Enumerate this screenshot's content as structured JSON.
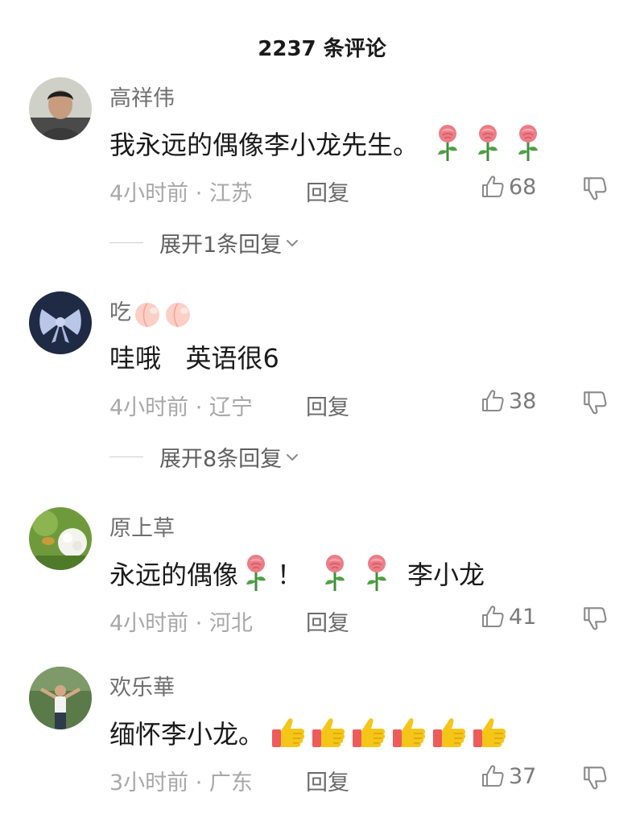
{
  "header": {
    "title": "2237 条评论"
  },
  "comments": [
    {
      "username": "高祥伟",
      "content": "我永远的偶像李小龙先生。",
      "content_emojis": [
        "rose",
        "rose",
        "rose"
      ],
      "time_location": "4小时前 · 江苏",
      "reply_label": "回复",
      "likes": "68",
      "expand_label": "展开1条回复"
    },
    {
      "username": "吃",
      "username_emojis": [
        "peach",
        "peach"
      ],
      "content": "哇哦   英语很6",
      "time_location": "4小时前 · 辽宁",
      "reply_label": "回复",
      "likes": "38",
      "expand_label": "展开8条回复"
    },
    {
      "username": "原上草",
      "content_a": "永远的偶像",
      "content_b": "！",
      "content_c": "李小龙",
      "content_emojis": [
        "rose",
        "rose",
        "rose"
      ],
      "time_location": "4小时前 · 河北",
      "reply_label": "回复",
      "likes": "41"
    },
    {
      "username": "欢乐華",
      "content": "缅怀李小龙。",
      "content_emojis": [
        "thumbs-up",
        "thumbs-up",
        "thumbs-up",
        "thumbs-up",
        "thumbs-up",
        "thumbs-up"
      ],
      "time_location": "3小时前 · 广东",
      "reply_label": "回复",
      "likes": "37"
    }
  ],
  "colors": {
    "meta": "#a8a8a8",
    "username": "#6f6f6f",
    "rose": "#e8707a",
    "thumb": "#f5c518"
  }
}
